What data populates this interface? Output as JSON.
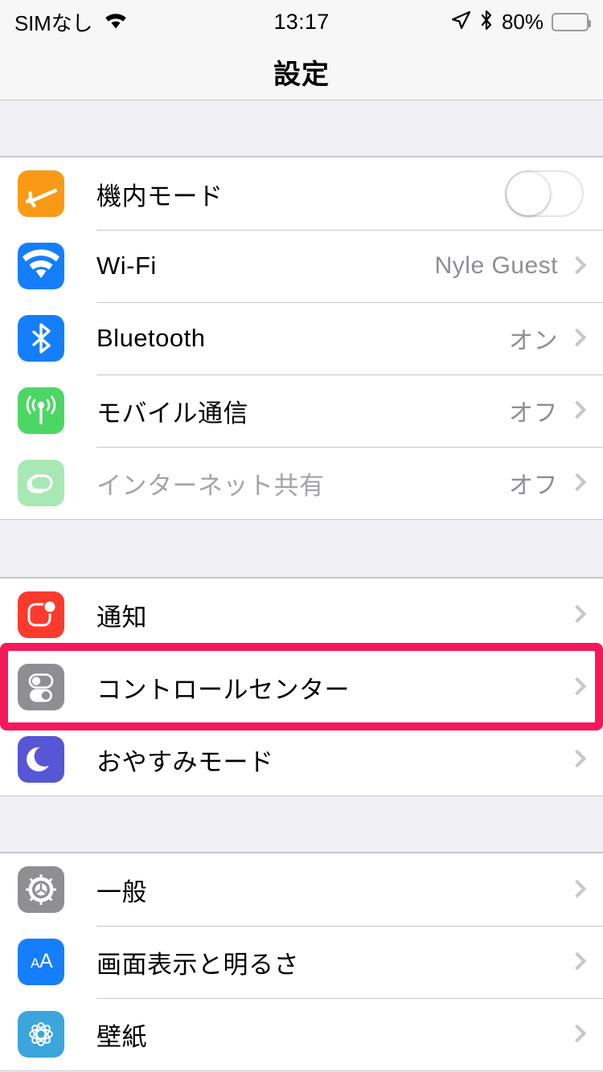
{
  "status_bar": {
    "carrier": "SIMなし",
    "wifi_icon": "wifi-icon",
    "time": "13:17",
    "location_icon": "location-arrow-icon",
    "bluetooth_icon": "bluetooth-icon",
    "battery_percent": "80%",
    "battery_icon": "battery-icon"
  },
  "nav": {
    "title": "設定"
  },
  "highlight": {
    "color": "#F5185B",
    "target": "コントロールセンター"
  },
  "groups": [
    {
      "rows": [
        {
          "label": "機内モード",
          "icon": "airplane-icon",
          "icon_color": "#F99A16",
          "accessory": "toggle",
          "toggle_on": false
        },
        {
          "label": "Wi-Fi",
          "icon": "wifi-icon",
          "icon_color": "#157EFB",
          "accessory": "chevron",
          "value": "Nyle Guest"
        },
        {
          "label": "Bluetooth",
          "icon": "bluetooth-icon",
          "icon_color": "#157EFB",
          "accessory": "chevron",
          "value": "オン"
        },
        {
          "label": "モバイル通信",
          "icon": "cellular-icon",
          "icon_color": "#4CD764",
          "accessory": "chevron",
          "value": "オフ"
        },
        {
          "label": "インターネット共有",
          "icon": "personal-hotspot-icon",
          "icon_color": "#A8E8B4",
          "accessory": "chevron",
          "value": "オフ",
          "disabled": true
        }
      ]
    },
    {
      "rows": [
        {
          "label": "通知",
          "icon": "notifications-icon",
          "icon_color": "#FC3B2D",
          "accessory": "chevron",
          "value": ""
        },
        {
          "label": "コントロールセンター",
          "icon": "control-center-icon",
          "icon_color": "#8E8E93",
          "accessory": "chevron",
          "value": "",
          "highlighted": true
        },
        {
          "label": "おやすみモード",
          "icon": "do-not-disturb-icon",
          "icon_color": "#5756D5",
          "accessory": "chevron",
          "value": ""
        }
      ]
    },
    {
      "rows": [
        {
          "label": "一般",
          "icon": "general-gear-icon",
          "icon_color": "#8E8E93",
          "accessory": "chevron",
          "value": ""
        },
        {
          "label": "画面表示と明るさ",
          "icon": "display-brightness-icon",
          "icon_color": "#157EFB",
          "accessory": "chevron",
          "value": ""
        },
        {
          "label": "壁紙",
          "icon": "wallpaper-icon",
          "icon_color": "#3BA5DC",
          "accessory": "chevron",
          "value": ""
        }
      ]
    }
  ]
}
